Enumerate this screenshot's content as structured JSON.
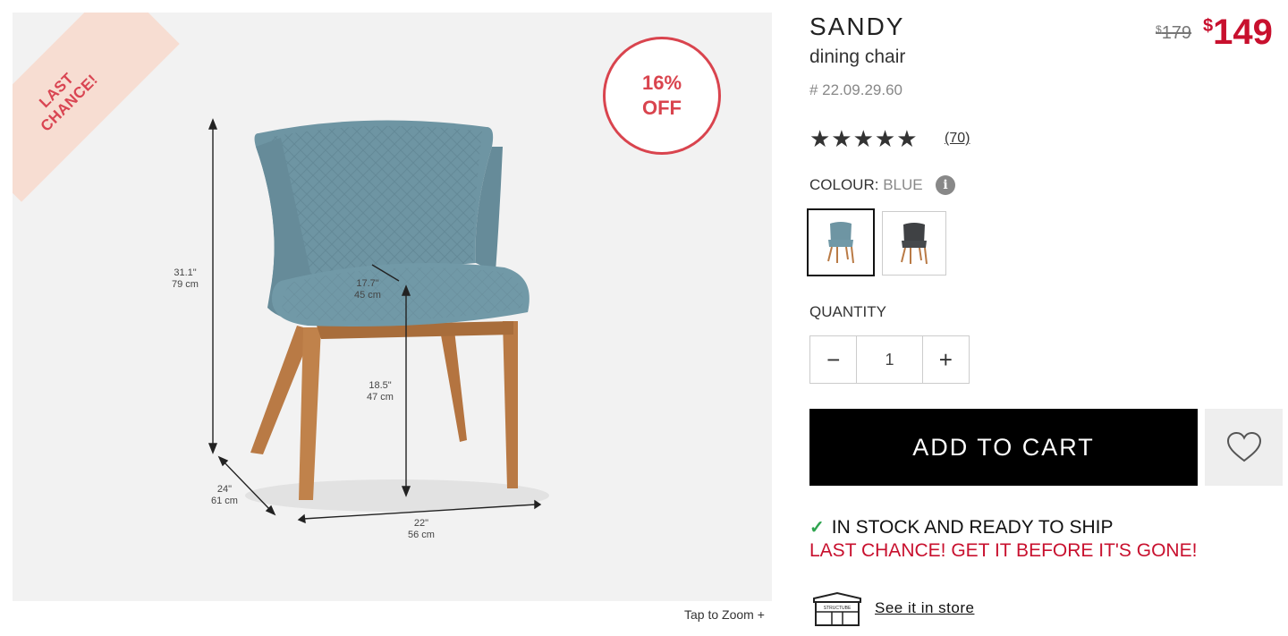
{
  "badge": {
    "ribbon_line1": "LAST",
    "ribbon_line2": "CHANCE!",
    "discount_line1": "16%",
    "discount_line2": "OFF"
  },
  "dimensions": {
    "height": "31.1\"",
    "height_cm": "79 cm",
    "seat_depth": "17.7\"",
    "seat_depth_cm": "45 cm",
    "seat_height": "18.5\"",
    "seat_height_cm": "47 cm",
    "depth": "24\"",
    "depth_cm": "61 cm",
    "width": "22\"",
    "width_cm": "56 cm"
  },
  "zoom": {
    "label": "Tap to Zoom +"
  },
  "product": {
    "name": "SANDY",
    "type": "dining chair",
    "sku": "# 22.09.29.60",
    "old_price_symbol": "$",
    "old_price": "179",
    "price_symbol": "$",
    "price": "149",
    "stars": "★★★★★",
    "rating": 5,
    "reviews": "(70)"
  },
  "colour": {
    "label": "COLOUR:",
    "selected": "BLUE",
    "info_icon": "i",
    "swatches": [
      {
        "name": "blue",
        "color": "#6e95a3"
      },
      {
        "name": "charcoal",
        "color": "#3f4144"
      }
    ]
  },
  "quantity": {
    "label": "QUANTITY",
    "minus": "−",
    "value": "1",
    "plus": "+"
  },
  "actions": {
    "add_to_cart": "ADD TO CART"
  },
  "stock": {
    "check": "✓",
    "status": "IN STOCK AND READY TO SHIP",
    "urgency": "LAST CHANCE! GET IT BEFORE IT'S GONE!"
  },
  "store": {
    "icon_text": "STRUCTUBE",
    "link": "See it in store"
  },
  "colors": {
    "accent_red": "#c8102e",
    "chair_blue": "#6e95a3",
    "wood": "#b97a45"
  }
}
